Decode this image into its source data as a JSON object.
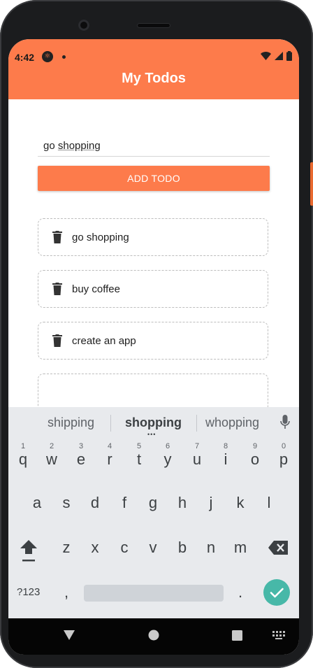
{
  "status": {
    "time": "4:42"
  },
  "app": {
    "title": "My Todos",
    "input_value_plain": "go ",
    "input_value_underlined": "shopping",
    "add_button": "ADD TODO",
    "todos": [
      "go shopping",
      "buy coffee",
      "create an app"
    ]
  },
  "keyboard": {
    "suggestions": [
      "shipping",
      "shopping",
      "whopping"
    ],
    "row1": [
      "q",
      "w",
      "e",
      "r",
      "t",
      "y",
      "u",
      "i",
      "o",
      "p"
    ],
    "row1_digits": [
      "1",
      "2",
      "3",
      "4",
      "5",
      "6",
      "7",
      "8",
      "9",
      "0"
    ],
    "row2": [
      "a",
      "s",
      "d",
      "f",
      "g",
      "h",
      "j",
      "k",
      "l"
    ],
    "row3": [
      "z",
      "x",
      "c",
      "v",
      "b",
      "n",
      "m"
    ],
    "symbols_key": "?123",
    "comma": ",",
    "period": "."
  },
  "colors": {
    "accent": "#fd7b4b",
    "enter": "#47b8a8",
    "keyboard_bg": "#e8eaed"
  }
}
